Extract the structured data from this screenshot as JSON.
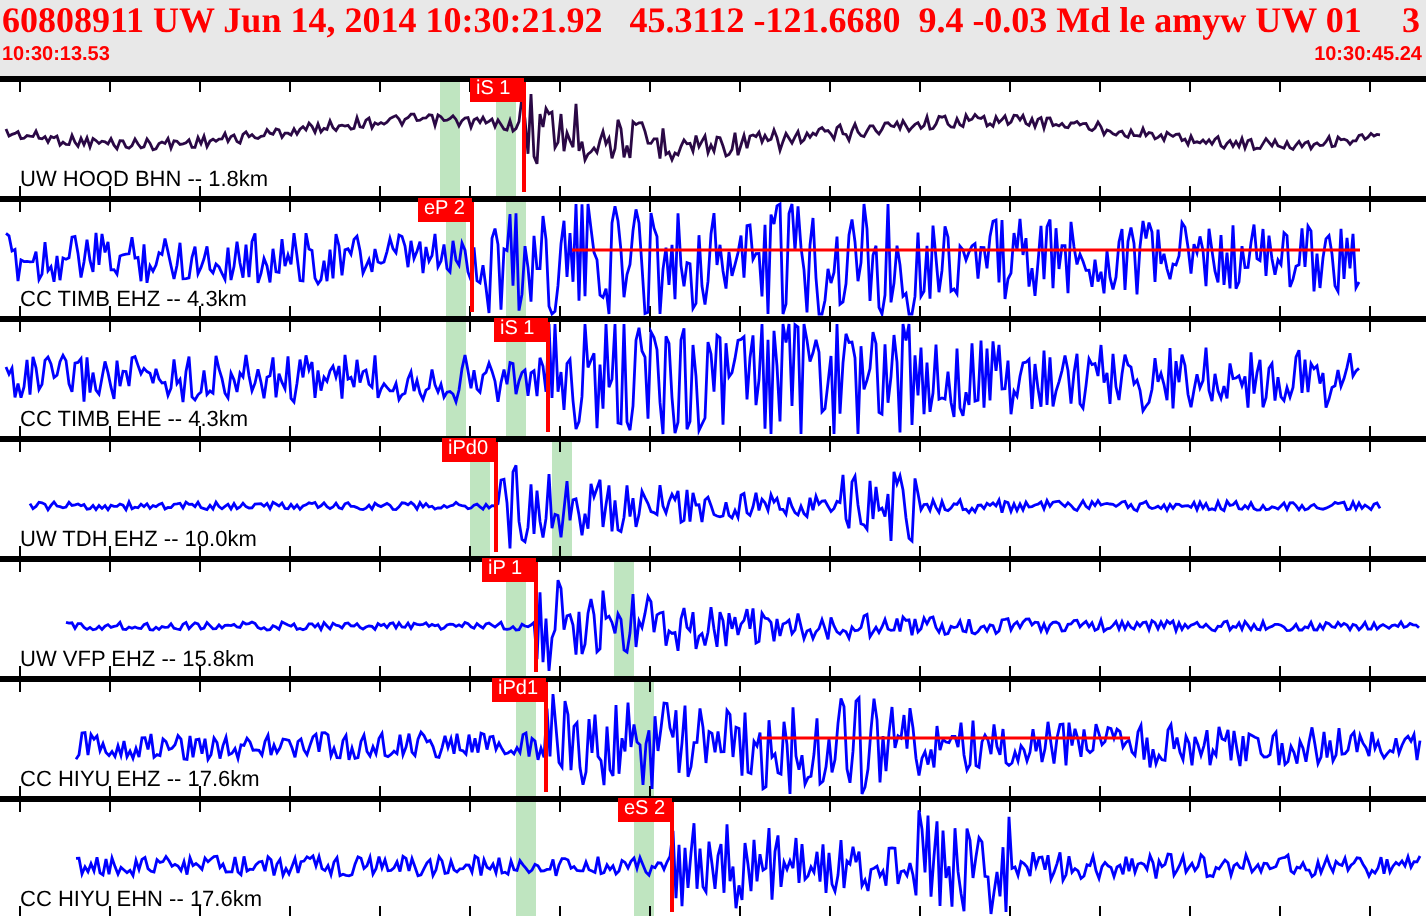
{
  "header": {
    "title": "60808911 UW Jun 14, 2014 10:30:21.92   45.3112 -121.6680  9.4 -0.03 Md le amyw UW 01",
    "title_tail": "3",
    "start_time": "10:30:13.53",
    "end_time": "10:30:45.24"
  },
  "traces": [
    {
      "label": "UW HOOD BHN -- 1.8km",
      "color": "#2a0845",
      "pick": "iS 1"
    },
    {
      "label": "CC TIMB EHZ -- 4.3km",
      "color": "#0000ff",
      "pick": "eP 2"
    },
    {
      "label": "CC TIMB EHE -- 4.3km",
      "color": "#0000ff",
      "pick": "iS 1"
    },
    {
      "label": "UW TDH EHZ -- 10.0km",
      "color": "#0000ff",
      "pick": "iPd0"
    },
    {
      "label": "UW VFP EHZ -- 15.8km",
      "color": "#0000ff",
      "pick": "iP 1"
    },
    {
      "label": "CC HIYU EHZ -- 17.6km",
      "color": "#0000ff",
      "pick": "iPd1"
    },
    {
      "label": "CC HIYU EHN -- 17.6km",
      "color": "#0000ff",
      "pick": "eS 2"
    }
  ]
}
